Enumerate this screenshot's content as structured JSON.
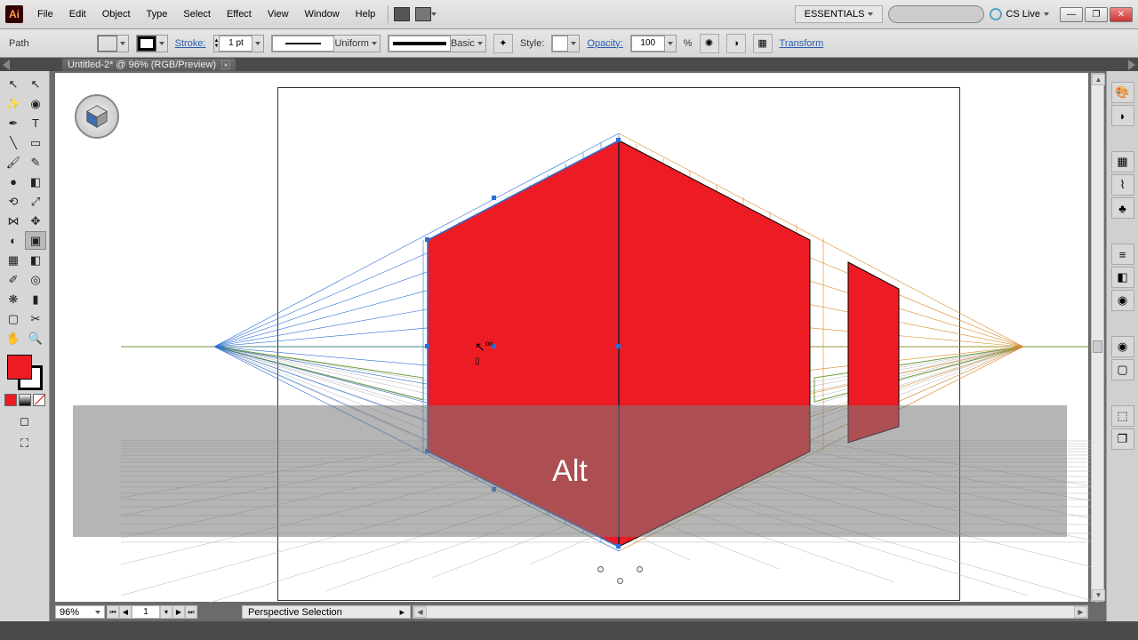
{
  "app": {
    "name": "Ai"
  },
  "menu": [
    "File",
    "Edit",
    "Object",
    "Type",
    "Select",
    "Effect",
    "View",
    "Window",
    "Help"
  ],
  "workspace": "ESSENTIALS",
  "cslive": "CS Live",
  "control": {
    "selection": "Path",
    "fill_color": "#ed1c24",
    "stroke_color": "#000000",
    "stroke_label": "Stroke:",
    "stroke_weight": "1 pt",
    "profile": "Uniform",
    "brush": "Basic",
    "style_label": "Style:",
    "opacity_label": "Opacity:",
    "opacity_value": "100",
    "opacity_unit": "%",
    "transform": "Transform"
  },
  "tab": {
    "title": "Untitled-2* @ 96% (RGB/Preview)"
  },
  "status": {
    "zoom": "96%",
    "page": "1",
    "tool": "Perspective Selection"
  },
  "overlay": {
    "key": "Alt"
  },
  "cursor_hint": "on"
}
